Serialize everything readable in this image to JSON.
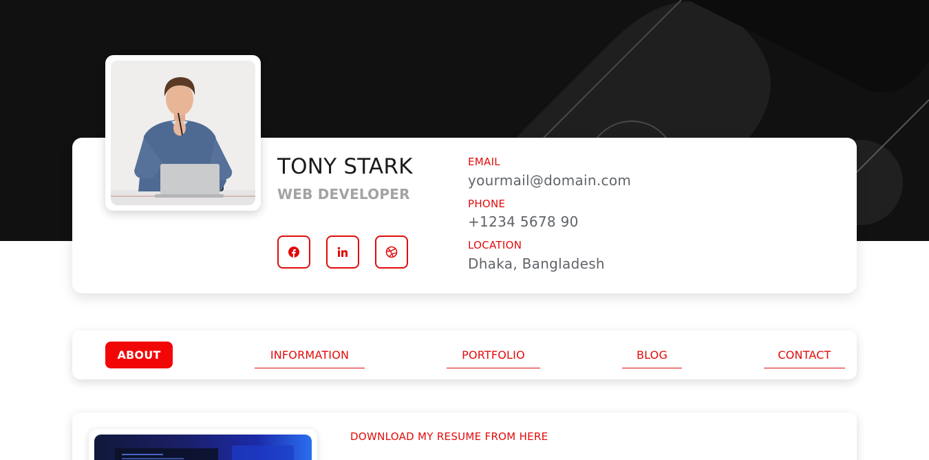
{
  "profile": {
    "name": "TONY STARK",
    "role": "WEB DEVELOPER",
    "photo_icon": "profile-photo"
  },
  "social": [
    {
      "icon": "facebook-icon",
      "label": "Facebook"
    },
    {
      "icon": "linkedin-icon",
      "label": "LinkedIn"
    },
    {
      "icon": "dribbble-icon",
      "label": "Dribbble"
    }
  ],
  "info": {
    "email_label": "EMAIL",
    "email_value": "yourmail@domain.com",
    "phone_label": "PHONE",
    "phone_value": "+1234 5678 90",
    "location_label": "LOCATION",
    "location_value": "Dhaka, Bangladesh"
  },
  "nav": {
    "items": [
      {
        "label": "ABOUT",
        "active": true
      },
      {
        "label": "INFORMATION",
        "active": false
      },
      {
        "label": "PORTFOLIO",
        "active": false
      },
      {
        "label": "BLOG",
        "active": false
      },
      {
        "label": "CONTACT",
        "active": false
      }
    ]
  },
  "about": {
    "download_label": "DOWNLOAD MY RESUME FROM HERE"
  },
  "colors": {
    "accent": "#e10a0a",
    "hero_bg": "#111112",
    "text_muted": "#5f6368"
  }
}
